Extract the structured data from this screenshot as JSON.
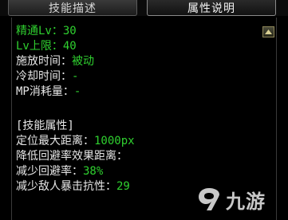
{
  "tabs": [
    {
      "label": "技能描述",
      "active": false
    },
    {
      "label": "属性说明",
      "active": true
    }
  ],
  "basic": [
    {
      "label": "精通Lv",
      "sep": "：",
      "value": "30",
      "color": "#2fd02f"
    },
    {
      "label": "Lv上限",
      "sep": "：",
      "value": "40",
      "color": "#2fd02f"
    },
    {
      "label": "施放时间",
      "sep": "：",
      "value": "被动",
      "label_color": "#e6e6e6",
      "value_color": "#2fd02f"
    },
    {
      "label": "冷却时间",
      "sep": "：",
      "value": "-",
      "label_color": "#e6e6e6",
      "value_color": "#2fd02f"
    },
    {
      "label": "MP消耗量",
      "sep": "：",
      "value": "-",
      "label_color": "#e6e6e6",
      "value_color": "#2fd02f"
    }
  ],
  "attributes": {
    "header": "[技能属性]",
    "items": [
      {
        "label": "定位最大距离",
        "sep": "：",
        "value": "1000px"
      },
      {
        "label": "降低回避率效果距离",
        "sep": "：",
        "value": ""
      },
      {
        "label": "减少回避率",
        "sep": "：",
        "value": "38%"
      },
      {
        "label": "减少敌人暴击抗性",
        "sep": "：",
        "value": "29"
      }
    ]
  },
  "watermark": {
    "text": "九游",
    "icon": "9game-logo-icon"
  },
  "scroll_icon": "scroll-up-arrow-icon"
}
